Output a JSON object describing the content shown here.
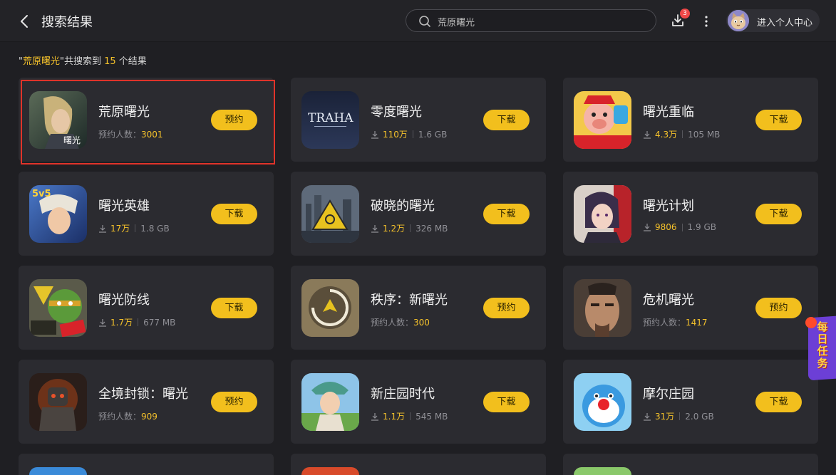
{
  "header": {
    "title": "搜索结果",
    "search_value": "荒原曙光",
    "download_badge": "3",
    "profile_label": "进入个人中心"
  },
  "summary": {
    "quote_open": "\"",
    "keyword": "荒原曙光",
    "middle": "\"共搜索到 ",
    "count": "15",
    "suffix": " 个结果"
  },
  "cards": [
    {
      "name": "荒原曙光",
      "mode": "reserve",
      "reserve_label": "预约人数：",
      "reserve_count": "3001",
      "action": "预约"
    },
    {
      "name": "零度曙光",
      "mode": "download",
      "downloads": "110万",
      "size": "1.6 GB",
      "action": "下载"
    },
    {
      "name": "曙光重临",
      "mode": "download",
      "downloads": "4.3万",
      "size": "105 MB",
      "action": "下载"
    },
    {
      "name": "曙光英雄",
      "mode": "download",
      "downloads": "17万",
      "size": "1.8 GB",
      "action": "下载"
    },
    {
      "name": "破晓的曙光",
      "mode": "download",
      "downloads": "1.2万",
      "size": "326 MB",
      "action": "下载"
    },
    {
      "name": "曙光计划",
      "mode": "download",
      "downloads": "9806",
      "size": "1.9 GB",
      "action": "下载"
    },
    {
      "name": "曙光防线",
      "mode": "download",
      "downloads": "1.7万",
      "size": "677 MB",
      "action": "下载"
    },
    {
      "name": "秩序：新曙光",
      "mode": "reserve",
      "reserve_label": "预约人数：",
      "reserve_count": "300",
      "action": "预约"
    },
    {
      "name": "危机曙光",
      "mode": "reserve",
      "reserve_label": "预约人数：",
      "reserve_count": "1417",
      "action": "预约"
    },
    {
      "name": "全境封锁：曙光",
      "mode": "reserve",
      "reserve_label": "预约人数：",
      "reserve_count": "909",
      "action": "预约"
    },
    {
      "name": "新庄园时代",
      "mode": "download",
      "downloads": "1.1万",
      "size": "545 MB",
      "action": "下载"
    },
    {
      "name": "摩尔庄园",
      "mode": "download",
      "downloads": "31万",
      "size": "2.0 GB",
      "action": "下载"
    }
  ],
  "task_float": {
    "label": "每日任务"
  },
  "colors": {
    "accent": "#f2bf1d",
    "background": "#1f1f23",
    "card": "#2b2b30",
    "highlight": "#e0332a",
    "badge": "#f04848"
  },
  "icons": [
    "back-arrow-icon",
    "search-icon",
    "download-icon",
    "more-vertical-icon",
    "avatar-cat-icon"
  ]
}
